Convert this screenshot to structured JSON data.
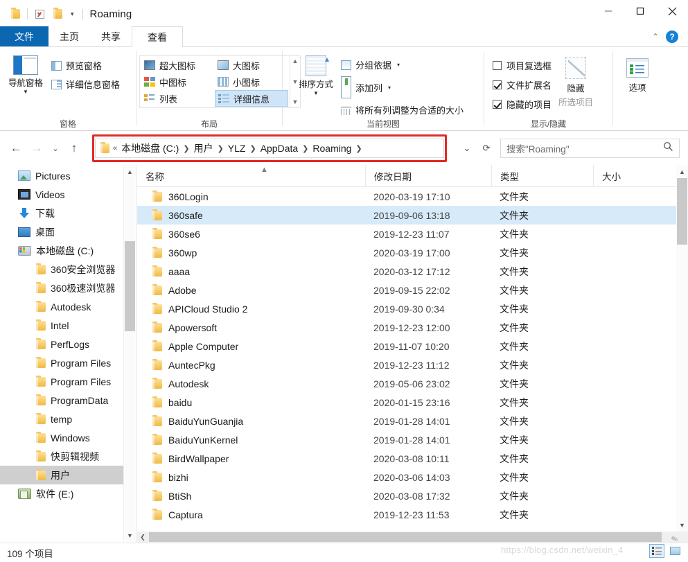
{
  "window": {
    "title": "Roaming",
    "quick_access": [
      "folder-icon",
      "properties-checkbox-icon",
      "new-folder-icon"
    ],
    "controls": {
      "minimize": "minimize-icon",
      "maximize": "maximize-icon",
      "close": "close-icon"
    }
  },
  "ribbon": {
    "tabs": [
      {
        "label": "文件",
        "id": "file"
      },
      {
        "label": "主页",
        "id": "home"
      },
      {
        "label": "共享",
        "id": "share"
      },
      {
        "label": "查看",
        "id": "view",
        "active": true
      }
    ],
    "help_label": "?",
    "groups": [
      {
        "name": "窗格",
        "big_button": "导航窗格",
        "items": [
          {
            "label": "预览窗格",
            "icon": "preview-pane-icon"
          },
          {
            "label": "详细信息窗格",
            "icon": "details-pane-icon"
          }
        ]
      },
      {
        "name": "布局",
        "gallery": [
          {
            "label": "超大图标",
            "icon": "extra-large-icons-icon"
          },
          {
            "label": "大图标",
            "icon": "large-icons-icon"
          },
          {
            "label": "中图标",
            "icon": "medium-icons-icon"
          },
          {
            "label": "小图标",
            "icon": "small-icons-icon"
          },
          {
            "label": "列表",
            "icon": "list-view-icon"
          },
          {
            "label": "详细信息",
            "icon": "details-view-icon",
            "selected": true
          }
        ]
      },
      {
        "name": "当前视图",
        "big_button": "排序方式",
        "items": [
          {
            "label": "分组依据",
            "icon": "group-by-icon",
            "has_caret": true
          },
          {
            "label": "添加列",
            "icon": "add-column-icon",
            "has_caret": true
          },
          {
            "label": "将所有列调整为合适的大小",
            "icon": "fit-columns-icon",
            "has_caret": false
          }
        ]
      },
      {
        "name": "显示/隐藏",
        "checkboxes": [
          {
            "label": "项目复选框",
            "checked": false
          },
          {
            "label": "文件扩展名",
            "checked": true
          },
          {
            "label": "隐藏的项目",
            "checked": true
          }
        ],
        "hide_button": {
          "label": "隐藏",
          "sublabel": "所选项目"
        },
        "options_button": {
          "label": "选项"
        }
      }
    ]
  },
  "navigation": {
    "back": "back-arrow-icon",
    "forward": "forward-arrow-icon",
    "recent": "recent-locations-icon",
    "up": "up-arrow-icon",
    "breadcrumbs": [
      "本地磁盘 (C:)",
      "用户",
      "YLZ",
      "AppData",
      "Roaming"
    ],
    "overflow": "«",
    "history_dropdown": "history-dropdown-icon",
    "refresh": "refresh-icon",
    "highlight_color": "#e02a26"
  },
  "search": {
    "placeholder": "搜索\"Roaming\"",
    "icon": "search-icon"
  },
  "sidebar": {
    "items": [
      {
        "label": "Pictures",
        "icon": "pictures-icon",
        "indent": 0
      },
      {
        "label": "Videos",
        "icon": "videos-icon",
        "indent": 0
      },
      {
        "label": "下载",
        "icon": "downloads-icon",
        "indent": 0
      },
      {
        "label": "桌面",
        "icon": "desktop-icon",
        "indent": 0
      },
      {
        "label": "本地磁盘 (C:)",
        "icon": "local-disk-icon",
        "indent": 0
      },
      {
        "label": "360安全浏览器",
        "icon": "folder-icon",
        "indent": 1
      },
      {
        "label": "360极速浏览器",
        "icon": "folder-icon",
        "indent": 1
      },
      {
        "label": "Autodesk",
        "icon": "folder-icon",
        "indent": 1
      },
      {
        "label": "Intel",
        "icon": "folder-icon",
        "indent": 1
      },
      {
        "label": "PerfLogs",
        "icon": "folder-icon",
        "indent": 1
      },
      {
        "label": "Program Files",
        "icon": "folder-icon",
        "indent": 1
      },
      {
        "label": "Program Files",
        "icon": "folder-icon",
        "indent": 1
      },
      {
        "label": "ProgramData",
        "icon": "folder-icon",
        "indent": 1
      },
      {
        "label": "temp",
        "icon": "folder-icon",
        "indent": 1
      },
      {
        "label": "Windows",
        "icon": "folder-icon",
        "indent": 1
      },
      {
        "label": "快剪辑视频",
        "icon": "folder-icon",
        "indent": 1
      },
      {
        "label": "用户",
        "icon": "folder-icon",
        "indent": 1,
        "selected": true
      },
      {
        "label": "软件 (E:)",
        "icon": "drive-e-icon",
        "indent": 0
      }
    ]
  },
  "filelist": {
    "columns": [
      {
        "label": "名称",
        "key": "name",
        "sorted": true
      },
      {
        "label": "修改日期",
        "key": "date"
      },
      {
        "label": "类型",
        "key": "type"
      },
      {
        "label": "大小",
        "key": "size"
      }
    ],
    "sort_indicator": "▲",
    "rows": [
      {
        "name": "360Login",
        "date": "2020-03-19 17:10",
        "type": "文件夹",
        "size": ""
      },
      {
        "name": "360safe",
        "date": "2019-09-06 13:18",
        "type": "文件夹",
        "size": "",
        "selected": true
      },
      {
        "name": "360se6",
        "date": "2019-12-23 11:07",
        "type": "文件夹",
        "size": ""
      },
      {
        "name": "360wp",
        "date": "2020-03-19 17:00",
        "type": "文件夹",
        "size": ""
      },
      {
        "name": "aaaa",
        "date": "2020-03-12 17:12",
        "type": "文件夹",
        "size": ""
      },
      {
        "name": "Adobe",
        "date": "2019-09-15 22:02",
        "type": "文件夹",
        "size": ""
      },
      {
        "name": "APICloud Studio 2",
        "date": "2019-09-30 0:34",
        "type": "文件夹",
        "size": ""
      },
      {
        "name": "Apowersoft",
        "date": "2019-12-23 12:00",
        "type": "文件夹",
        "size": ""
      },
      {
        "name": "Apple Computer",
        "date": "2019-11-07 10:20",
        "type": "文件夹",
        "size": ""
      },
      {
        "name": "AuntecPkg",
        "date": "2019-12-23 11:12",
        "type": "文件夹",
        "size": ""
      },
      {
        "name": "Autodesk",
        "date": "2019-05-06 23:02",
        "type": "文件夹",
        "size": ""
      },
      {
        "name": "baidu",
        "date": "2020-01-15 23:16",
        "type": "文件夹",
        "size": ""
      },
      {
        "name": "BaiduYunGuanjia",
        "date": "2019-01-28 14:01",
        "type": "文件夹",
        "size": ""
      },
      {
        "name": "BaiduYunKernel",
        "date": "2019-01-28 14:01",
        "type": "文件夹",
        "size": ""
      },
      {
        "name": "BirdWallpaper",
        "date": "2020-03-08 10:11",
        "type": "文件夹",
        "size": ""
      },
      {
        "name": "bizhi",
        "date": "2020-03-06 14:03",
        "type": "文件夹",
        "size": ""
      },
      {
        "name": "BtiSh",
        "date": "2020-03-08 17:32",
        "type": "文件夹",
        "size": ""
      },
      {
        "name": "Captura",
        "date": "2019-12-23 11:53",
        "type": "文件夹",
        "size": ""
      }
    ]
  },
  "statusbar": {
    "item_count": "109 个项目",
    "watermark": "https://blog.csdn.net/weixin_4",
    "view_buttons": [
      {
        "name": "details-view-button",
        "active": true
      },
      {
        "name": "large-icons-view-button",
        "active": false
      }
    ]
  }
}
